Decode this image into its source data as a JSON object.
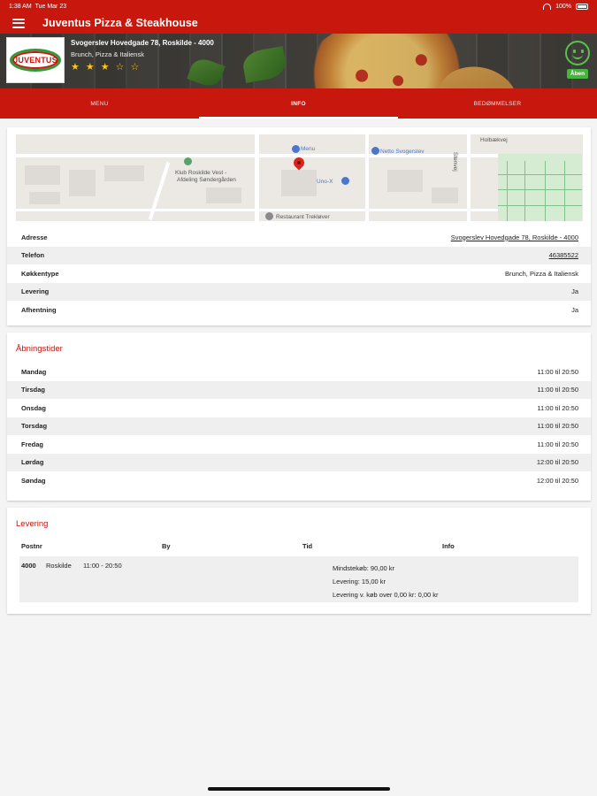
{
  "status_bar": {
    "time": "1:38 AM",
    "date": "Tue Mar 23",
    "battery": "100%"
  },
  "app_bar": {
    "title": "Juventus Pizza & Steakhouse"
  },
  "restaurant": {
    "logo_text": "JUVENTUS",
    "address": "Svogerslev Hovedgade 78, Roskilde - 4000",
    "cuisine": "Brunch, Pizza & Italiensk",
    "rating_stars": [
      "★",
      "★",
      "★",
      "☆",
      "☆"
    ],
    "rating": 3,
    "open_label": "Åben"
  },
  "tabs": [
    {
      "label": "MENU",
      "active": false
    },
    {
      "label": "INFO",
      "active": true
    },
    {
      "label": "BEDØMMELSER",
      "active": false
    }
  ],
  "map": {
    "labels": {
      "holbaekvej": "Holbækvej",
      "klub": "Klub Roskilde Vest -",
      "klub2": "Afdeling Søndergården",
      "menu_place": "Menu",
      "uno_x": "Uno-X",
      "netto": "Netto Svogerslev",
      "restaurant_bottom": "Restaurant Trekløver",
      "stenvej": "Stenvej"
    }
  },
  "info": {
    "rows": [
      {
        "key": "Adresse",
        "value": "Svogerslev Hovedgade 78, Roskilde - 4000",
        "link": true
      },
      {
        "key": "Telefon",
        "value": "46385522",
        "link": true
      },
      {
        "key": "Køkkentype",
        "value": "Brunch, Pizza & Italiensk",
        "link": false
      },
      {
        "key": "Levering",
        "value": "Ja",
        "link": false
      },
      {
        "key": "Afhentning",
        "value": "Ja",
        "link": false
      }
    ]
  },
  "hours": {
    "title": "Åbningstider",
    "rows": [
      {
        "day": "Mandag",
        "time": "11:00 til 20:50"
      },
      {
        "day": "Tirsdag",
        "time": "11:00 til 20:50"
      },
      {
        "day": "Onsdag",
        "time": "11:00 til 20:50"
      },
      {
        "day": "Torsdag",
        "time": "11:00 til 20:50"
      },
      {
        "day": "Fredag",
        "time": "11:00 til 20:50"
      },
      {
        "day": "Lørdag",
        "time": "12:00 til 20:50"
      },
      {
        "day": "Søndag",
        "time": "12:00 til 20:50"
      }
    ]
  },
  "delivery": {
    "title": "Levering",
    "headers": {
      "postnr": "Postnr",
      "by": "By",
      "tid": "Tid",
      "info": "Info"
    },
    "row": {
      "postnr": "4000",
      "by": "Roskilde",
      "tid": "11:00 - 20:50",
      "info": [
        "Mindstekøb: 90,00 kr",
        "Levering: 15,00 kr",
        "Levering v. køb over 0,00 kr: 0,00 kr"
      ]
    }
  }
}
